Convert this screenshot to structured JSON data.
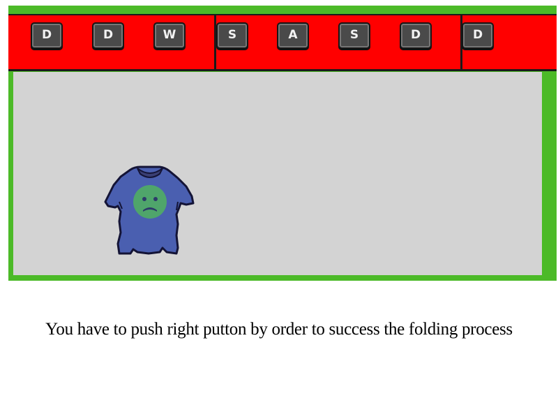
{
  "keys": [
    "D",
    "D",
    "W",
    "S",
    "A",
    "S",
    "D",
    "D"
  ],
  "instruction": "You have to push right putton by order to success the folding process",
  "colors": {
    "frame": "#4cba28",
    "key_bar": "#ff0000",
    "play_area": "#d3d3d3",
    "key_face": "#4a4a4a",
    "shirt": "#4a5fb0",
    "face": "#4fa56b"
  },
  "icons": {
    "shirt": "tshirt-icon",
    "face": "sad-face-icon"
  }
}
